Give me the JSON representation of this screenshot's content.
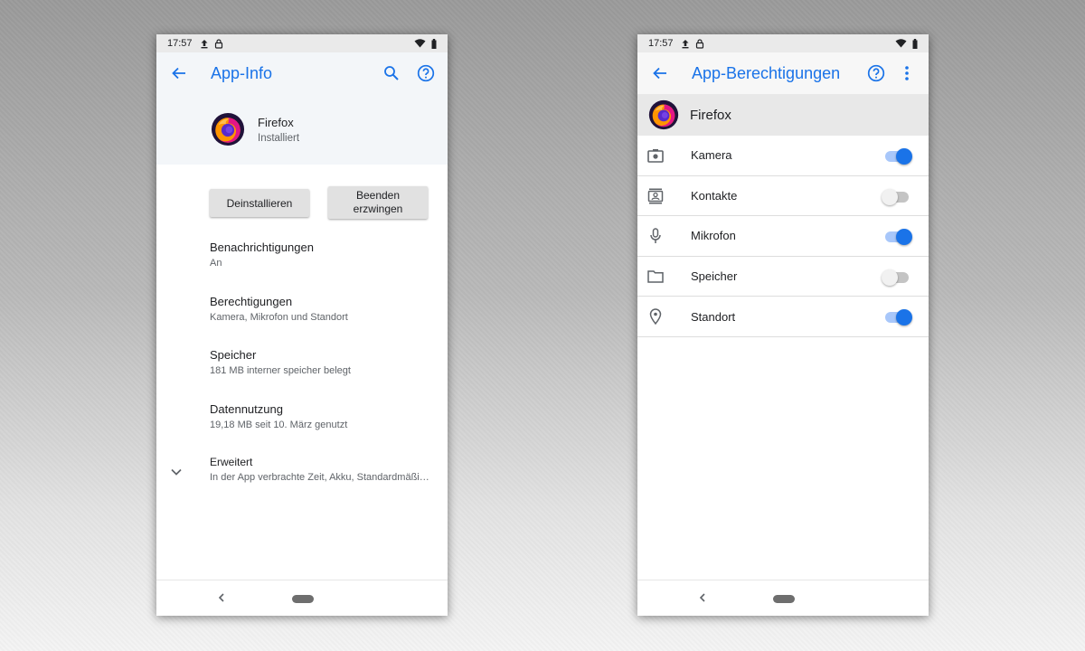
{
  "colors": {
    "accent": "#1a73e8",
    "toggle_on": "#1a73e8",
    "toggle_off": "#f1f1f1"
  },
  "left": {
    "status": {
      "time": "17:57",
      "icons": [
        "upload-icon",
        "lock-icon",
        "wifi-icon",
        "battery-icon"
      ]
    },
    "appbar": {
      "title": "App-Info",
      "icons": [
        "back-arrow-icon",
        "search-icon",
        "help-icon"
      ]
    },
    "app": {
      "name": "Firefox",
      "state": "Installiert",
      "icon": "firefox-logo"
    },
    "buttons": {
      "uninstall": "Deinstallieren",
      "forcestop": "Beenden erzwingen"
    },
    "items": [
      {
        "title": "Benachrichtigungen",
        "subtitle": "An"
      },
      {
        "title": "Berechtigungen",
        "subtitle": "Kamera, Mikrofon und Standort"
      },
      {
        "title": "Speicher",
        "subtitle": "181 MB interner speicher belegt"
      },
      {
        "title": "Datennutzung",
        "subtitle": "19,18 MB seit 10. März genutzt"
      }
    ],
    "advanced": {
      "title": "Erweitert",
      "subtitle": "In der App verbrachte Zeit, Akku, Standardmäßi…",
      "icon": "chevron-down-icon"
    }
  },
  "right": {
    "status": {
      "time": "17:57",
      "icons": [
        "upload-icon",
        "lock-icon",
        "wifi-icon",
        "battery-icon"
      ]
    },
    "appbar": {
      "title": "App-Berechtigungen",
      "icons": [
        "back-arrow-icon",
        "help-icon",
        "more-vert-icon"
      ]
    },
    "app": {
      "name": "Firefox",
      "icon": "firefox-logo"
    },
    "permissions": [
      {
        "label": "Kamera",
        "icon": "camera-icon",
        "enabled": true
      },
      {
        "label": "Kontakte",
        "icon": "contacts-icon",
        "enabled": false
      },
      {
        "label": "Mikrofon",
        "icon": "microphone-icon",
        "enabled": true
      },
      {
        "label": "Speicher",
        "icon": "folder-icon",
        "enabled": false
      },
      {
        "label": "Standort",
        "icon": "location-icon",
        "enabled": true
      }
    ]
  }
}
